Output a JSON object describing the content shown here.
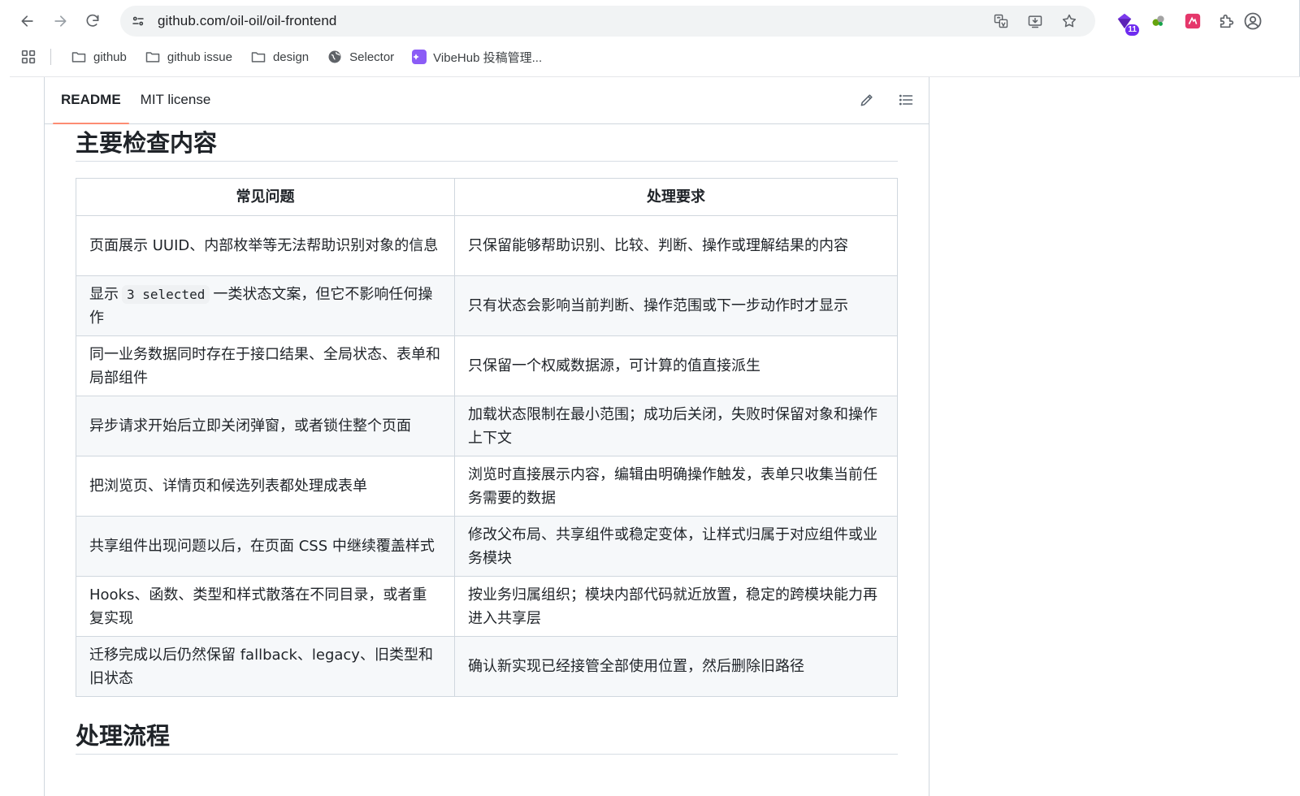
{
  "browser": {
    "url": "github.com/oil-oil/oil-frontend",
    "extension_badge": "11"
  },
  "bookmarks": [
    {
      "label": "github",
      "icon": "folder-icon"
    },
    {
      "label": "github issue",
      "icon": "folder-icon"
    },
    {
      "label": "design",
      "icon": "folder-icon"
    },
    {
      "label": "Selector",
      "icon": "globe-icon"
    },
    {
      "label": "VibeHub 投稿管理...",
      "icon": "vibehub-icon"
    }
  ],
  "readme": {
    "tabs": [
      {
        "label": "README",
        "active": true
      },
      {
        "label": "MIT license",
        "active": false
      }
    ],
    "section_title": "主要检查内容",
    "next_section_title": "处理流程",
    "table": {
      "headers": [
        "常见问题",
        "处理要求"
      ],
      "rows": [
        {
          "problem": "页面展示 UUID、内部枚举等无法帮助识别对象的信息",
          "requirement": "只保留能够帮助识别、比较、判断、操作或理解结果的内容"
        },
        {
          "problem_before": "显示",
          "problem_code": "3 selected",
          "problem_after": "一类状态文案，但它不影响任何操作",
          "requirement": "只有状态会影响当前判断、操作范围或下一步动作时才显示"
        },
        {
          "problem": "同一业务数据同时存在于接口结果、全局状态、表单和局部组件",
          "requirement": "只保留一个权威数据源，可计算的值直接派生"
        },
        {
          "problem": "异步请求开始后立即关闭弹窗，或者锁住整个页面",
          "requirement": "加载状态限制在最小范围；成功后关闭，失败时保留对象和操作上下文"
        },
        {
          "problem": "把浏览页、详情页和候选列表都处理成表单",
          "requirement": "浏览时直接展示内容，编辑由明确操作触发，表单只收集当前任务需要的数据"
        },
        {
          "problem": "共享组件出现问题以后，在页面 CSS 中继续覆盖样式",
          "requirement": "修改父布局、共享组件或稳定变体，让样式归属于对应组件或业务模块"
        },
        {
          "problem": "Hooks、函数、类型和样式散落在不同目录，或者重复实现",
          "requirement": "按业务归属组织；模块内部代码就近放置，稳定的跨模块能力再进入共享层"
        },
        {
          "problem": "迁移完成以后仍然保留 fallback、legacy、旧类型和旧状态",
          "requirement": "确认新实现已经接管全部使用位置，然后删除旧路径"
        }
      ]
    }
  }
}
